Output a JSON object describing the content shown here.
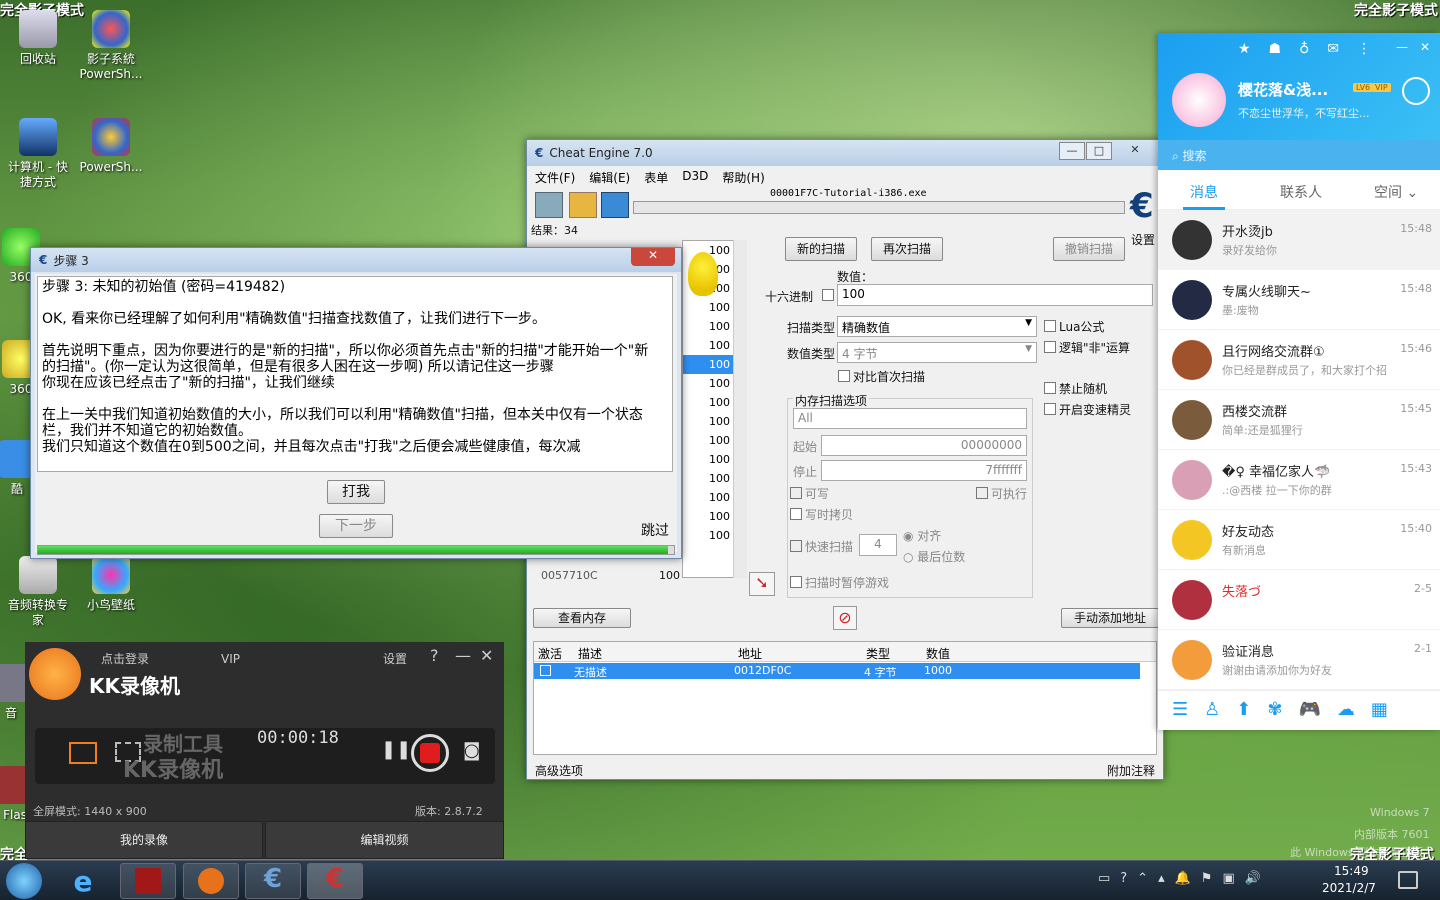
{
  "watermarks": {
    "top_left": "完全影子模式",
    "top_right": "完全影子模式",
    "bottom_left": "完全",
    "bottom_right": "完全影子模式"
  },
  "desktop_icons": [
    {
      "label": "回收站"
    },
    {
      "label": "影子系統 PowerSh..."
    },
    {
      "label": "计算机 - 快 捷方式"
    },
    {
      "label": "PowerSh..."
    },
    {
      "label": "音频转换专 家"
    },
    {
      "label": "小鸟壁纸"
    },
    {
      "label": "360"
    },
    {
      "label": "360"
    },
    {
      "label": "酷"
    },
    {
      "label": "音"
    },
    {
      "label": "Flas"
    }
  ],
  "ce": {
    "title": "Cheat Engine 7.0",
    "menu": [
      "文件(F)",
      "编辑(E)",
      "表单",
      "D3D",
      "帮助(H)"
    ],
    "process": "00001F7C-Tutorial-i386.exe",
    "results": "结果：34",
    "settings": "设置",
    "first_scan": "新的扫描",
    "next_scan": "再次扫描",
    "undo_scan": "撤销扫描",
    "value_label": "数值：",
    "hex": "十六进制",
    "value": "100",
    "scan_type_label": "扫描类型",
    "scan_type": "精确数值",
    "value_type_label": "数值类型",
    "value_type": "4 字节",
    "compare_first": "对比首次扫描",
    "lua": "Lua公式",
    "not_op": "逻辑\"非\"运算",
    "no_random": "禁止随机",
    "speedhack": "开启变速精灵",
    "mem_options": "内存扫描选项",
    "mem_all": "All",
    "start_label": "起始",
    "start": "00000000",
    "stop_label": "停止",
    "stop": "7fffffff",
    "writable": "可写",
    "executable": "可执行",
    "copy_on_write": "写时拷贝",
    "fast_scan": "快速扫描",
    "fast_val": "4",
    "align": "对齐",
    "last_digits": "最后位数",
    "pause_game": "扫描时暂停游戏",
    "list_values": [
      "100",
      "100",
      "100",
      "100",
      "100",
      "100",
      "100",
      "100",
      "100",
      "100",
      "100",
      "100",
      "100",
      "100",
      "100",
      "100"
    ],
    "last_row_addr": "0057710C",
    "last_row_val": "100",
    "view_memory": "查看内存",
    "add_manual": "手动添加地址",
    "table_headers": [
      "激活",
      "描述",
      "地址",
      "类型",
      "数值"
    ],
    "table_row": {
      "desc": "无描述",
      "addr": "0012DF0C",
      "type": "4 字节",
      "value": "1000"
    },
    "advanced": "高级选项",
    "comments": "附加注释"
  },
  "step": {
    "title": "步骤 3",
    "heading": "步骤 3: 未知的初始值 (密码=419482)",
    "p1": "OK, 看来你已经理解了如何利用\"精确数值\"扫描查找数值了，让我们进行下一步。",
    "p2": "首先说明下重点，因为你要进行的是\"新的扫描\"，所以你必须首先点击\"新的扫描\"才能开始一个\"新的扫描\"。(你一定认为这很简单，但是有很多人困在这一步啊) 所以请记住这一步骤",
    "p3": "你现在应该已经点击了\"新的扫描\"，让我们继续",
    "p4": "在上一关中我们知道初始数值的大小，所以我们可以利用\"精确数值\"扫描，但本关中仅有一个状态栏，我们并不知道它的初始数值。",
    "p5": "我们只知道这个数值在0到500之间，并且每次点击\"打我\"之后便会减些健康值，每次减",
    "hit": "打我",
    "next": "下一步",
    "skip": "跳过",
    "progress": 0.99
  },
  "qq": {
    "nickname": "樱花落&浅...",
    "badges": [
      "LV6",
      "VIP"
    ],
    "signature": "不恋尘世浮华，不写红尘...",
    "search": "搜索",
    "tabs": [
      "消息",
      "联系人",
      "空间"
    ],
    "chats": [
      {
        "name": "开水烫jb",
        "msg": "录好发给你",
        "time": "15:48",
        "color": "#333"
      },
      {
        "name": "专属火线聊天~",
        "msg": "墨:废物",
        "time": "15:48",
        "color": "#222a44"
      },
      {
        "name": "且行网络交流群①",
        "msg": "你已经是群成员了，和大家打个招",
        "time": "15:46",
        "color": "#a0522d"
      },
      {
        "name": "西楼交流群",
        "msg": "简单:还是狐狸行",
        "time": "15:45",
        "color": "#7a5c3c"
      },
      {
        "name": "�♀ 幸福亿家人🦈",
        "msg": ".:@西楼 拉一下你的群",
        "time": "15:43",
        "color": "#d9a0b5"
      },
      {
        "name": "好友动态",
        "msg": "有新消息",
        "time": "15:40",
        "color": "#f3c623"
      },
      {
        "name": "失落づ",
        "msg": "",
        "time": "2-5",
        "color": "#b03040"
      },
      {
        "name": "验证消息",
        "msg": "谢谢由请添加你为好友",
        "time": "2-1",
        "color": "#f39c3c"
      }
    ]
  },
  "kk": {
    "login": "点击登录",
    "vip": "VIP",
    "settings": "设置",
    "help": "?",
    "brand": "KK录像机",
    "time": "00:00:18",
    "overlay1": "录制工具",
    "overlay2": "KK录像机",
    "mode": "全屏模式: 1440 x 900",
    "version": "版本: 2.8.7.2",
    "my_videos": "我的录像",
    "edit_video": "编辑视频"
  },
  "taskbar": {
    "time": "15:49",
    "date": "2021/2/7",
    "win_text": "Windows 7",
    "build": "内部版本 7601",
    "notice": "此 Windows 副本不是正版"
  }
}
